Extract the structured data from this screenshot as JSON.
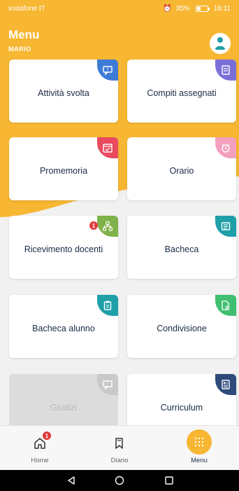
{
  "statusbar": {
    "carrier": "vodafone IT",
    "battery": "35%",
    "time": "18:11"
  },
  "header": {
    "title": "Menu",
    "subtitle": "MARIO",
    "brand_color": "#f7b733"
  },
  "tiles": [
    {
      "label": "Attività svolta",
      "icon": "chat-question-icon",
      "color": "#3d7bd6",
      "enabled": true
    },
    {
      "label": "Compiti assegnati",
      "icon": "task-list-icon",
      "color": "#7a6fd8",
      "enabled": true
    },
    {
      "label": "Promemoria",
      "icon": "calendar-check-icon",
      "color": "#e84a5f",
      "enabled": true
    },
    {
      "label": "Orario",
      "icon": "alarm-clock-icon",
      "color": "#f3a0bf",
      "enabled": true
    },
    {
      "label": "Ricevimento docenti",
      "icon": "teachers-meeting-icon",
      "color": "#7fb24a",
      "enabled": true,
      "notification": "1"
    },
    {
      "label": "Bacheca",
      "icon": "board-icon",
      "color": "#1f9fa8",
      "enabled": true
    },
    {
      "label": "Bacheca alunno",
      "icon": "clipboard-icon",
      "color": "#1f9fa8",
      "enabled": true
    },
    {
      "label": "Condivisione",
      "icon": "share-document-icon",
      "color": "#3fbf6f",
      "enabled": true
    },
    {
      "label": "Giudizi",
      "icon": "comment-icon",
      "color": "#c9c9c9",
      "enabled": false
    },
    {
      "label": "Curriculum",
      "icon": "curriculum-icon",
      "color": "#2d4a7a",
      "enabled": true
    }
  ],
  "nav": {
    "home_label": "Home",
    "home_notification": "1",
    "diario_label": "Diario",
    "menu_label": "Menu"
  }
}
